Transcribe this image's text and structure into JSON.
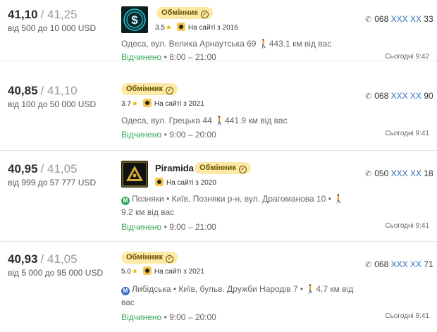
{
  "cards": [
    {
      "buy": "41,10",
      "sep": "/",
      "sell": "41,25",
      "range": "від 500 до 10 000 USD",
      "badge": "Обмінник",
      "rating": "3.5",
      "since": "На сайті з 2016",
      "address": "Одеса, вул. Велика Арнаутська 69",
      "distance": "443.1 км від вас",
      "status": "Відчинено",
      "hours": "8:00 – 21:00",
      "phone_prefix": "068",
      "phone_mask": "XXX XX",
      "phone_suffix": "33",
      "time": "Сьогодні 9:42"
    },
    {
      "buy": "40,85",
      "sep": "/",
      "sell": "41,10",
      "range": "від 100 до 50 000 USD",
      "badge": "Обмінник",
      "rating": "3.7",
      "since": "На сайті з 2021",
      "address": "Одеса, вул. Грецька 44",
      "distance": "441.9 км від вас",
      "status": "Відчинено",
      "hours": "9:00 – 20:00",
      "phone_prefix": "068",
      "phone_mask": "XXX XX",
      "phone_suffix": "90",
      "time": "Сьогодні 9:41"
    },
    {
      "buy": "40,95",
      "sep": "/",
      "sell": "41,05",
      "range": "від 999 до 57 777 USD",
      "name": "Piramida",
      "badge": "Обмінник",
      "since": "На сайті з 2020",
      "metro": "Позняки",
      "address": "Київ, Позняки р-н, вул. Драгоманова 10",
      "distance": "9.2 км від вас",
      "status": "Відчинено",
      "hours": "9:00 – 21:00",
      "phone_prefix": "050",
      "phone_mask": "XXX XX",
      "phone_suffix": "18",
      "time": "Сьогодні 9:41",
      "metro_color": "#3aa85a"
    },
    {
      "buy": "40,93",
      "sep": "/",
      "sell": "41,05",
      "range": "від 5 000 до 95 000 USD",
      "badge": "Обмінник",
      "rating": "5.0",
      "since": "На сайті з 2021",
      "metro": "Либідська",
      "address": "Київ, бульв. Дружби Народів 7",
      "distance": "4.7 км від вас",
      "status": "Відчинено",
      "hours": "9:00 – 20:00",
      "phone_prefix": "068",
      "phone_mask": "XXX XX",
      "phone_suffix": "71",
      "time": "Сьогодні 9:41",
      "metro_color": "#3a6fc4"
    }
  ],
  "icons": {
    "star": "star-icon",
    "medal": "medal-icon",
    "walk": "walk-icon",
    "phone": "phone-icon",
    "verified": "verified-check-icon"
  },
  "colors": {
    "badge_bg": "#fde9a6",
    "open": "#3aa85a",
    "phone_mask": "#2f6fb5"
  }
}
